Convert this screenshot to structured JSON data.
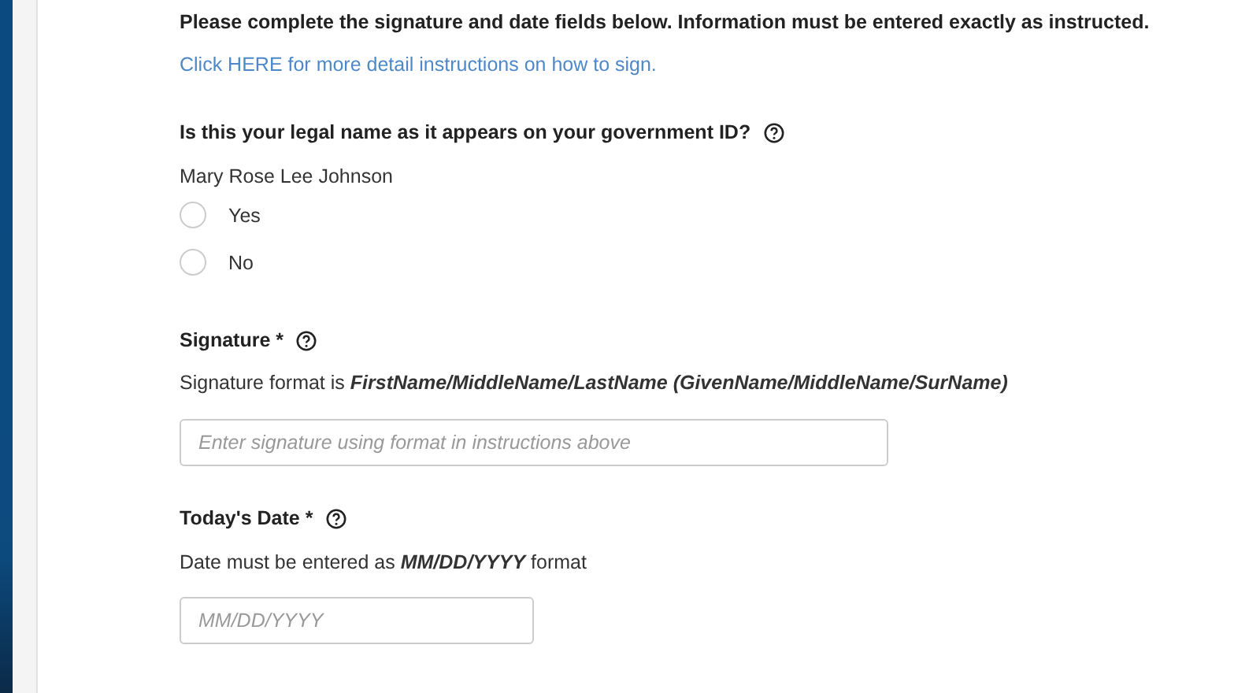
{
  "intro": "Please complete the signature and date fields below. Information must be entered exactly as instructed.",
  "help_link": "Click HERE for more detail instructions on how to sign.",
  "name_question": {
    "label": "Is this your legal name as it appears on your government ID?",
    "name": "Mary Rose Lee Johnson",
    "options": [
      {
        "label": "Yes",
        "selected": false
      },
      {
        "label": "No",
        "selected": false
      }
    ]
  },
  "signature": {
    "label": "Signature *",
    "hint": "Signature format is *FirstName/MiddleName/LastName (GivenName/MiddleName/SurName)*",
    "placeholder": "Enter signature using format in instructions above"
  },
  "date": {
    "label": "Today's Date *",
    "hint": "Date must be entered as *MM/DD/YYYY* format",
    "placeholder": "MM/DD/YYYY"
  }
}
